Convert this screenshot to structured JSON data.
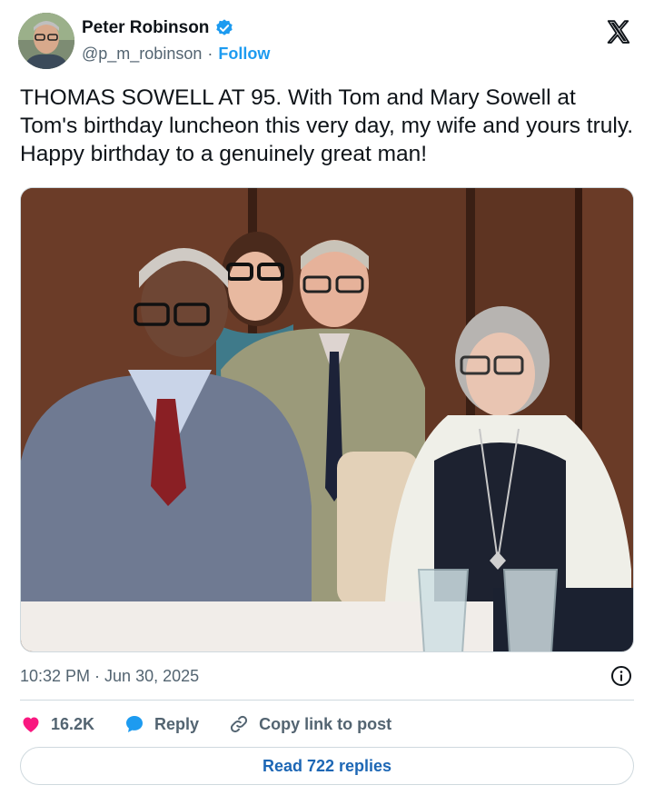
{
  "author": {
    "name": "Peter Robinson",
    "handle": "@p_m_robinson",
    "separator": "·",
    "follow_label": "Follow",
    "verified": true
  },
  "tweet": {
    "text": "THOMAS SOWELL AT 95. With Tom and Mary Sowell at Tom's birthday luncheon this very day, my wife and yours truly. Happy birthday to a genuinely great man!",
    "timestamp": "10:32 PM · Jun 30, 2025"
  },
  "actions": {
    "likes_count": "16.2K",
    "reply_label": "Reply",
    "copy_link_label": "Copy link to post"
  },
  "read_replies_label": "Read 722 replies",
  "icons": {
    "verified": "verified-badge-icon",
    "platform": "x-logo-icon",
    "info": "info-icon",
    "like": "heart-icon",
    "reply": "reply-bubble-icon",
    "copy": "link-icon"
  },
  "colors": {
    "accent": "#1d9bf0",
    "like": "#f91880",
    "text": "#0f1419",
    "secondary": "#536471",
    "border": "#cfd9de"
  }
}
